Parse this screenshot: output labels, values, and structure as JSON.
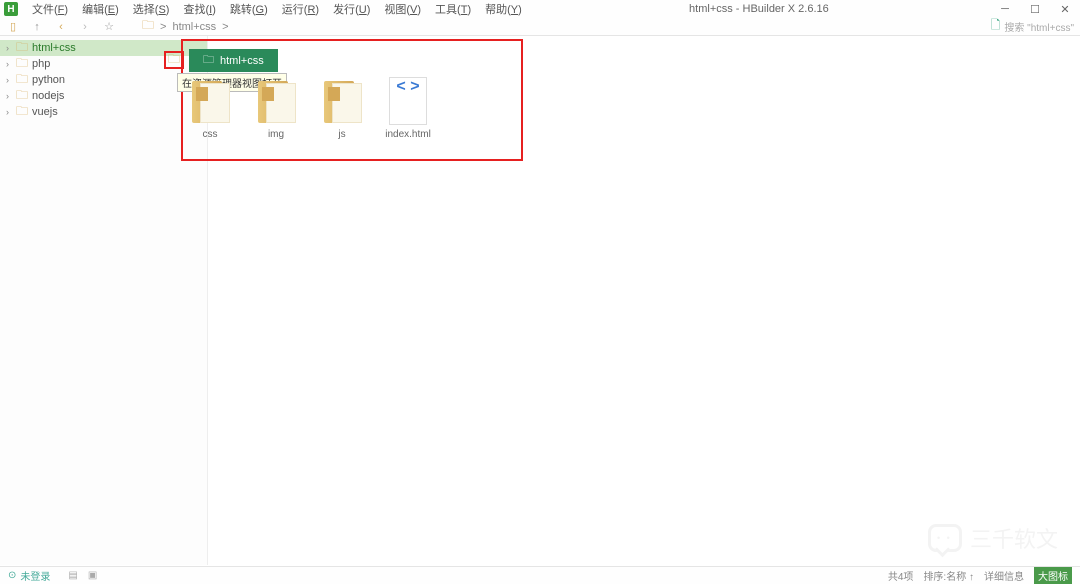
{
  "app": {
    "icon_letter": "H",
    "title": "html+css - HBuilder X 2.6.16"
  },
  "menu": [
    {
      "label": "文件",
      "key": "F"
    },
    {
      "label": "编辑",
      "key": "E"
    },
    {
      "label": "选择",
      "key": "S"
    },
    {
      "label": "查找",
      "key": "I"
    },
    {
      "label": "跳转",
      "key": "G"
    },
    {
      "label": "运行",
      "key": "R"
    },
    {
      "label": "发行",
      "key": "U"
    },
    {
      "label": "视图",
      "key": "V"
    },
    {
      "label": "工具",
      "key": "T"
    },
    {
      "label": "帮助",
      "key": "Y"
    }
  ],
  "breadcrumb": {
    "items": [
      "html+css"
    ],
    "sep": ">"
  },
  "search": {
    "placeholder": "搜索 \"html+css\""
  },
  "sidebar": {
    "items": [
      {
        "label": "html+css",
        "active": true
      },
      {
        "label": "php",
        "active": false
      },
      {
        "label": "python",
        "active": false
      },
      {
        "label": "nodejs",
        "active": false
      },
      {
        "label": "vuejs",
        "active": false
      }
    ]
  },
  "tab": {
    "label": "html+css"
  },
  "tooltip": "在资源管理器视图打开",
  "files": [
    {
      "name": "css",
      "type": "folder"
    },
    {
      "name": "img",
      "type": "folder"
    },
    {
      "name": "js",
      "type": "folder"
    },
    {
      "name": "index.html",
      "type": "file"
    }
  ],
  "statusbar": {
    "login": "未登录",
    "count": "共4项",
    "sort": "排序:名称 ↑",
    "detail": "详细信息",
    "bigicon": "大图标"
  },
  "watermark": "三千软文"
}
